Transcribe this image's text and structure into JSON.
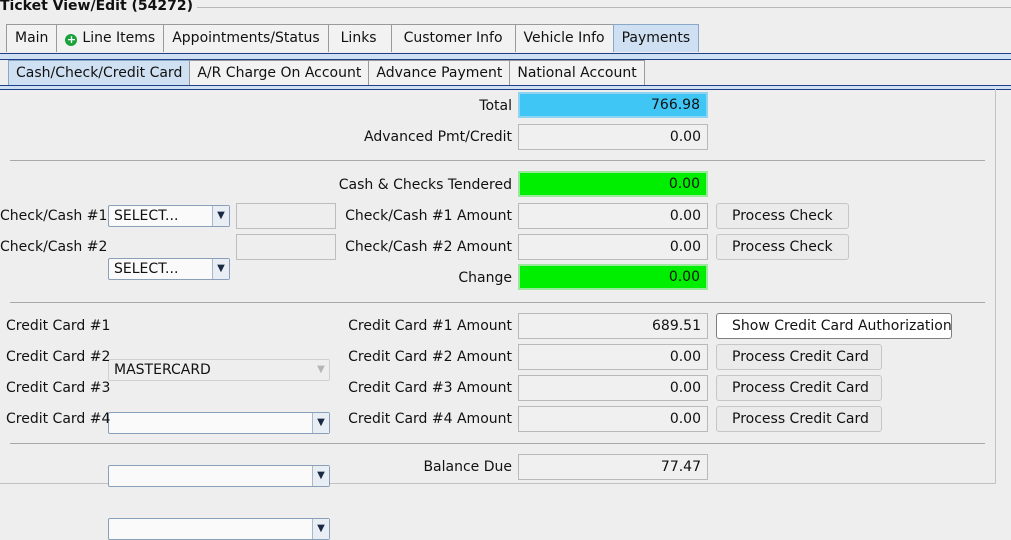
{
  "window": {
    "title": "Ticket View/Edit  (54272)"
  },
  "tabs": [
    {
      "label": "Main"
    },
    {
      "label": "Line Items",
      "icon": "plus-circle-icon"
    },
    {
      "label": "Appointments/Status"
    },
    {
      "label": "Links"
    },
    {
      "label": "Customer Info"
    },
    {
      "label": "Vehicle Info"
    },
    {
      "label": "Payments",
      "selected": true
    }
  ],
  "subtabs": [
    {
      "label": "Cash/Check/Credit Card",
      "selected": true
    },
    {
      "label": "A/R Charge On Account"
    },
    {
      "label": "Advance Payment"
    },
    {
      "label": "National Account"
    }
  ],
  "summary": {
    "total_label": "Total",
    "total_value": "766.98",
    "advanced_label": "Advanced Pmt/Credit",
    "advanced_value": "0.00"
  },
  "cash": {
    "tendered_label": "Cash & Checks Tendered",
    "tendered_value": "0.00",
    "check1_label": "Check/Cash #1",
    "check1_select": "SELECT...",
    "check1_amount_label": "Check/Cash #1 Amount",
    "check1_amount": "0.00",
    "check2_label": "Check/Cash #2",
    "check2_select": "SELECT...",
    "check2_amount_label": "Check/Cash #2 Amount",
    "check2_amount": "0.00",
    "process_check_label": "Process Check",
    "change_label": "Change",
    "change_value": "0.00"
  },
  "credit": {
    "cc1_label": "Credit Card #1",
    "cc1_value": "MASTERCARD",
    "cc1_amount_label": "Credit Card #1 Amount",
    "cc1_amount": "689.51",
    "show_auth_label": "Show Credit Card Authorization",
    "cc2_label": "Credit Card #2",
    "cc2_value": "",
    "cc2_amount_label": "Credit Card #2 Amount",
    "cc2_amount": "0.00",
    "cc3_label": "Credit Card #3",
    "cc3_value": "",
    "cc3_amount_label": "Credit Card #3 Amount",
    "cc3_amount": "0.00",
    "cc4_label": "Credit Card #4",
    "cc4_value": "",
    "cc4_amount_label": "Credit Card #4 Amount",
    "cc4_amount": "0.00",
    "process_cc_label": "Process Credit Card"
  },
  "balance": {
    "label": "Balance Due",
    "value": "77.47"
  },
  "colors": {
    "total_bg": "#3fc6f5",
    "green_bg": "#00ee00",
    "tab_selected_bg": "#cfe0f3"
  }
}
